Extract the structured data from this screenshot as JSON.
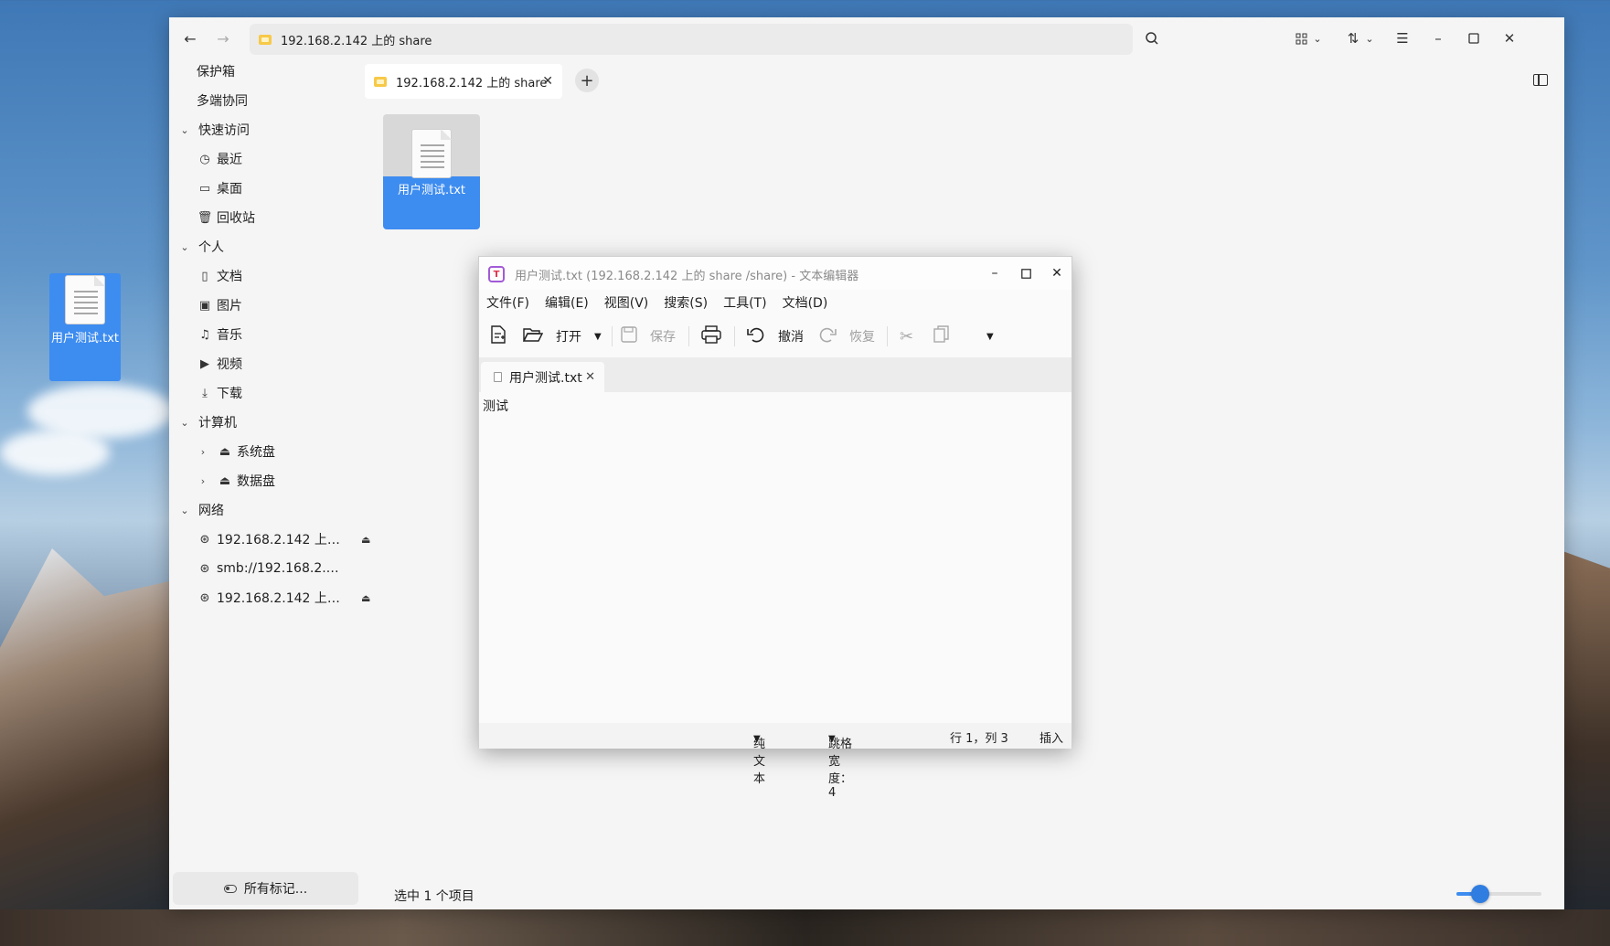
{
  "desktop": {
    "icon_label": "用户测试.txt"
  },
  "file_manager": {
    "address": "192.168.2.142 上的 share",
    "tab_label": "192.168.2.142 上的 share",
    "sidebar": {
      "vault": "保护箱",
      "collab": "多端协同",
      "quick_access": "快速访问",
      "recent": "最近",
      "desktop": "桌面",
      "trash": "回收站",
      "personal": "个人",
      "documents": "文档",
      "pictures": "图片",
      "music": "音乐",
      "videos": "视频",
      "downloads": "下载",
      "computer": "计算机",
      "system_disk": "系统盘",
      "data_disk": "数据盘",
      "network": "网络",
      "net1": "192.168.2.142 上…",
      "net2": "smb://192.168.2.…",
      "net3": "192.168.2.142 上…",
      "all_tags": "所有标记..."
    },
    "file_name": "用户测试.txt",
    "status": "选中 1 个项目",
    "icon_size_fraction": 0.28
  },
  "editor": {
    "title": "用户测试.txt (192.168.2.142 上的 share /share) - 文本编辑器",
    "menu": [
      "文件(F)",
      "编辑(E)",
      "视图(V)",
      "搜索(S)",
      "工具(T)",
      "文档(D)"
    ],
    "toolbar": {
      "open": "打开",
      "save": "保存",
      "undo": "撤消",
      "redo": "恢复"
    },
    "tab_label": "用户测试.txt",
    "content": "测试",
    "status": {
      "syntax": "纯文本",
      "tab_width": "跳格宽度： 4",
      "position": "行 1，列 3",
      "mode": "插入"
    }
  }
}
